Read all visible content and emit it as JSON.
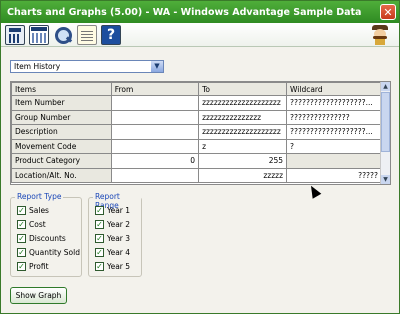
{
  "window": {
    "title": "Charts and Graphs (5.00) - WA - Windows Advantage Sample Data",
    "close_glyph": "✕"
  },
  "toolbar": {
    "icons": [
      "calculator-icon",
      "calendar-icon",
      "search-icon",
      "notes-icon",
      "help-icon"
    ],
    "help_glyph": "?"
  },
  "selector": {
    "value": "Item History",
    "arrow": "▼"
  },
  "grid": {
    "headers": [
      "Items",
      "From",
      "To",
      "Wildcard"
    ],
    "rows": [
      {
        "label": "Item Number",
        "from": "",
        "to": "zzzzzzzzzzzzzzzzzzzz",
        "wildcard": "???????????????????..."
      },
      {
        "label": "Group Number",
        "from": "",
        "to": "zzzzzzzzzzzzzzz",
        "wildcard": "???????????????"
      },
      {
        "label": "Description",
        "from": "",
        "to": "zzzzzzzzzzzzzzzzzzzz",
        "wildcard": "???????????????????..."
      },
      {
        "label": "Movement Code",
        "from": "",
        "to": "z",
        "wildcard": "?"
      },
      {
        "label": "Product Category",
        "from": "0",
        "to": "255",
        "wildcard": ""
      },
      {
        "label": "Location/Alt. No.",
        "from": "",
        "to": "zzzzz",
        "wildcard": "?????"
      }
    ]
  },
  "report_type": {
    "label": "Report Type",
    "items": [
      "Sales",
      "Cost",
      "Discounts",
      "Quantity Sold",
      "Profit"
    ]
  },
  "report_range": {
    "label": "Report Range",
    "items": [
      "Year 1",
      "Year 2",
      "Year 3",
      "Year 4",
      "Year 5"
    ]
  },
  "checkmark": "✓",
  "buttons": {
    "show_graph": "Show Graph"
  },
  "colors": {
    "titlebar": "#3b9a2c",
    "accent_blue": "#1a47b8"
  }
}
